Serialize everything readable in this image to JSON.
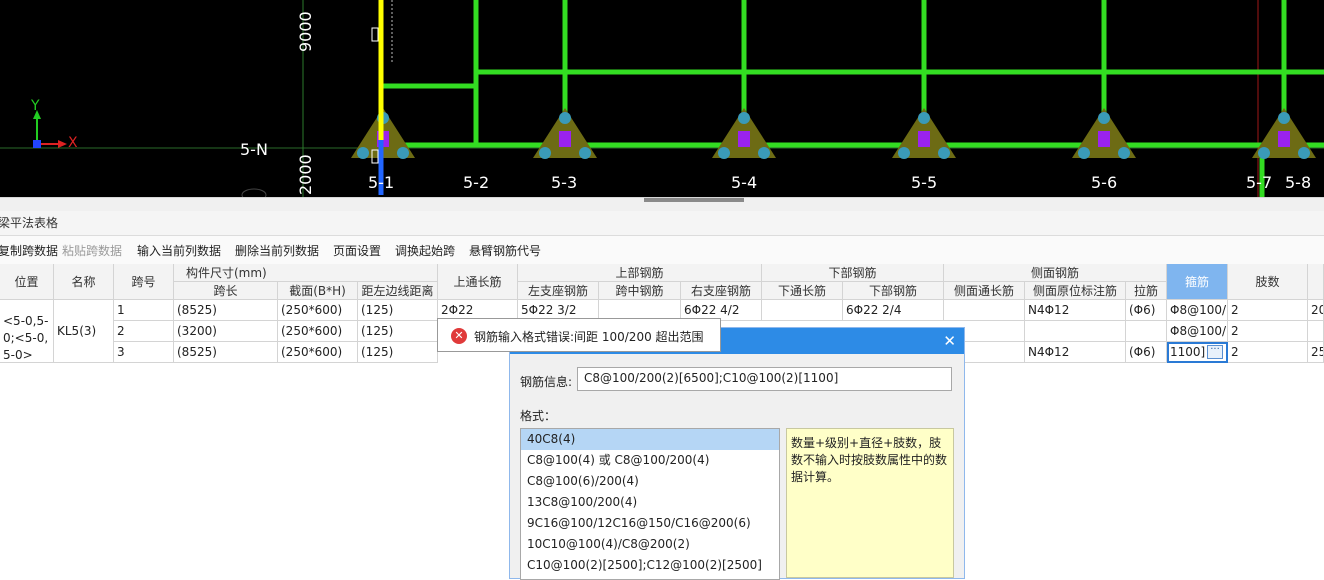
{
  "cad": {
    "dim_top": "9000",
    "dim_bottom": "2000",
    "axis_row_label": "5-N",
    "axis_y": "Y",
    "axis_x": "X",
    "column_labels": [
      "5-1",
      "5-2",
      "5-3",
      "5-4",
      "5-5",
      "5-6",
      "5-7",
      "5-8"
    ]
  },
  "panel": {
    "title": "梁平法表格"
  },
  "toolbar": [
    "复制跨数据",
    "粘贴跨数据",
    "输入当前列数据",
    "删除当前列数据",
    "页面设置",
    "调换起始跨",
    "悬臂钢筋代号"
  ],
  "table": {
    "headers": {
      "position": "位置",
      "name": "名称",
      "span_no": "跨号",
      "component_size": "构件尺寸(mm)",
      "span_len": "跨长",
      "section": "截面(B*H)",
      "edge_dist": "距左边线距离",
      "top_through": "上通长筋",
      "top_rebar": "上部钢筋",
      "left_support": "左支座钢筋",
      "mid_span": "跨中钢筋",
      "right_support": "右支座钢筋",
      "bottom_rebar": "下部钢筋",
      "bottom_through": "下通长筋",
      "bottom_bars": "下部钢筋",
      "side_rebar": "侧面钢筋",
      "side_through": "侧面通长筋",
      "side_marked": "侧面原位标注筋",
      "tie": "拉筋",
      "stirrup": "箍筋",
      "legs": "肢数"
    },
    "position_value": "<5-0,5-0;<5-0,5-0>",
    "name_value": "KL5(3)",
    "rows": [
      {
        "span": "1",
        "span_len": "(8525)",
        "section": "(250*600)",
        "edge": "(125)",
        "top_through": "2Φ22",
        "left": "5Φ22 3/2",
        "right": "6Φ22 4/2",
        "bottom": "6Φ22 2/4",
        "side_marked": "N4Φ12",
        "tie": "(Φ6)",
        "stirrup": "Φ8@100/",
        "legs": "2",
        "extra": "20"
      },
      {
        "span": "2",
        "span_len": "(3200)",
        "section": "(250*600)",
        "edge": "(125)",
        "top_through": "",
        "left": "",
        "right": "",
        "bottom": "",
        "side_marked": "",
        "tie": "",
        "stirrup": "Φ8@100/",
        "legs": "2",
        "extra": ""
      },
      {
        "span": "3",
        "span_len": "(8525)",
        "section": "(250*600)",
        "edge": "(125)",
        "top_through": "",
        "left": "",
        "right": "",
        "bottom": "",
        "side_marked": "N4Φ12",
        "tie": "(Φ6)",
        "stirrup": "1100]",
        "legs": "2",
        "extra": "25"
      }
    ]
  },
  "error_tip": {
    "text": "钢筋输入格式错误:间距 100/200 超出范围"
  },
  "dialog": {
    "info_label": "钢筋信息:",
    "info_value": "C8@100/200(2)[6500];C10@100(2)[1100]",
    "format_label": "格式：",
    "formats": [
      "40C8(4)",
      "C8@100(4) 或 C8@100/200(4)",
      "C8@100(6)/200(4)",
      "13C8@100/200(4)",
      "9C16@100/12C16@150/C16@200(6)",
      "10C10@100(4)/C8@200(2)",
      "C10@100(2)[2500];C12@100(2)[2500]"
    ],
    "selected_index": 0,
    "help_text": "数量+级别+直径+肢数，肢数不输入时按肢数属性中的数据计算。"
  }
}
